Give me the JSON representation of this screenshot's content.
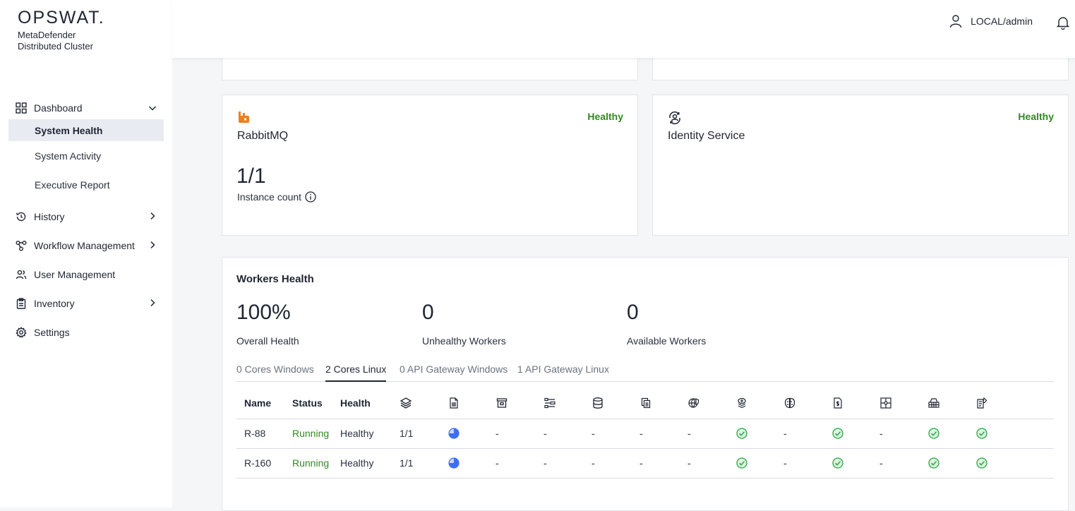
{
  "brand": {
    "logo": "OPSWAT.",
    "product_line1": "MetaDefender",
    "product_line2": "Distributed Cluster"
  },
  "user": {
    "name": "LOCAL/admin"
  },
  "sidebar": {
    "dashboard": "Dashboard",
    "sub": [
      "System Health",
      "System Activity",
      "Executive Report"
    ],
    "items": [
      "History",
      "Workflow Management",
      "User Management",
      "Inventory",
      "Settings"
    ]
  },
  "rabbitmq": {
    "title": "RabbitMQ",
    "status": "Healthy",
    "count": "1/1",
    "caption": "Instance count"
  },
  "identity": {
    "title": "Identity Service",
    "status": "Healthy"
  },
  "workers": {
    "title": "Workers Health",
    "overall": {
      "value": "100%",
      "label": "Overall Health"
    },
    "unhealthy": {
      "value": "0",
      "label": "Unhealthy Workers"
    },
    "available": {
      "value": "0",
      "label": "Available Workers"
    },
    "tabs": [
      "0 Cores Windows",
      "2 Cores Linux",
      "0 API Gateway Windows",
      "1 API Gateway Linux"
    ],
    "headers": [
      "Name",
      "Status",
      "Health"
    ],
    "rows": [
      {
        "name": "R-88",
        "status": "Running",
        "health": "Healthy",
        "ratio": "1/1",
        "dash": "-"
      },
      {
        "name": "R-160",
        "status": "Running",
        "health": "Healthy",
        "ratio": "1/1",
        "dash": "-"
      }
    ]
  },
  "colors": {
    "healthy": "#2f8a1f",
    "accent_orange": "#f07f1e",
    "check_green": "#27a745",
    "pie_blue": "#3d6ff0"
  }
}
